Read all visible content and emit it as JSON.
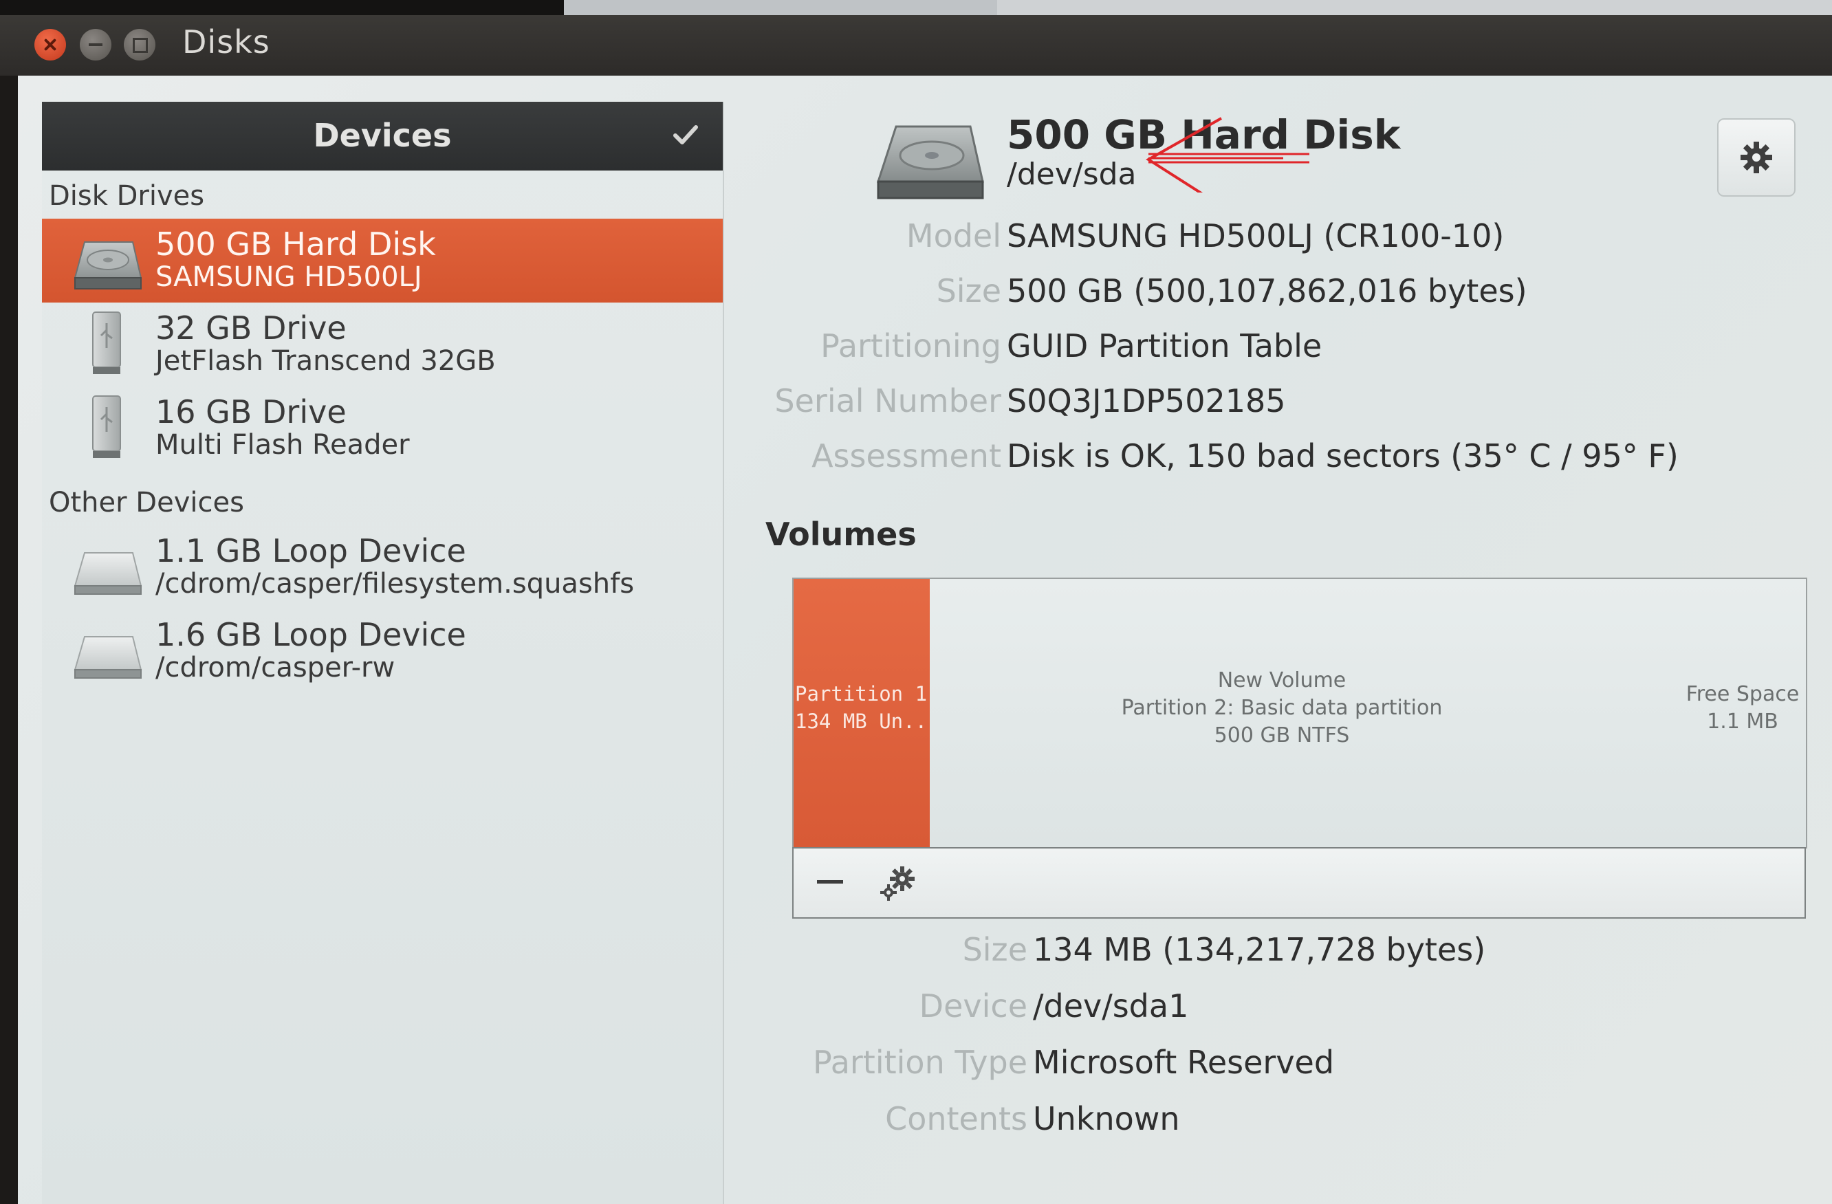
{
  "app": {
    "title": "Disks"
  },
  "sidebar": {
    "header": "Devices",
    "sections": [
      {
        "label": "Disk Drives"
      },
      {
        "label": "Other Devices"
      }
    ],
    "devices": [
      {
        "primary": "500 GB Hard Disk",
        "secondary": "SAMSUNG HD500LJ",
        "icon": "hard-disk-icon",
        "selected": true
      },
      {
        "primary": "32 GB Drive",
        "secondary": "JetFlash Transcend 32GB",
        "icon": "usb-drive-icon",
        "selected": false
      },
      {
        "primary": "16 GB Drive",
        "secondary": "Multi Flash Reader",
        "icon": "usb-drive-icon",
        "selected": false
      },
      {
        "primary": "1.1 GB Loop Device",
        "secondary": "/cdrom/casper/filesystem.squashfs",
        "icon": "loop-device-icon",
        "selected": false
      },
      {
        "primary": "1.6 GB Loop Device",
        "secondary": "/cdrom/casper-rw",
        "icon": "loop-device-icon",
        "selected": false
      }
    ]
  },
  "disk": {
    "name": "500 GB Hard Disk",
    "device": "/dev/sda",
    "properties": [
      {
        "label": "Model",
        "value": "SAMSUNG HD500LJ (CR100-10)"
      },
      {
        "label": "Size",
        "value": "500 GB (500,107,862,016 bytes)"
      },
      {
        "label": "Partitioning",
        "value": "GUID Partition Table"
      },
      {
        "label": "Serial Number",
        "value": "S0Q3J1DP502185"
      },
      {
        "label": "Assessment",
        "value": "Disk is OK, 150 bad sectors (35° C / 95° F)"
      }
    ]
  },
  "volumes": {
    "title": "Volumes",
    "partition1": {
      "line1": "Partition 1...",
      "line2": "134 MB Un..."
    },
    "partition2": {
      "line1": "New Volume",
      "line2": "Partition 2: Basic data partition",
      "line3": "500 GB NTFS"
    },
    "free_space": {
      "line1": "Free Space",
      "line2": "1.1 MB"
    },
    "details": [
      {
        "label": "Size",
        "value": "134 MB (134,217,728 bytes)"
      },
      {
        "label": "Device",
        "value": "/dev/sda1"
      },
      {
        "label": "Partition Type",
        "value": "Microsoft Reserved"
      },
      {
        "label": "Contents",
        "value": "Unknown"
      }
    ]
  },
  "colors": {
    "accent": "#dd5f38",
    "header_dark": "#2f3132",
    "annotation": "#e0262a"
  }
}
